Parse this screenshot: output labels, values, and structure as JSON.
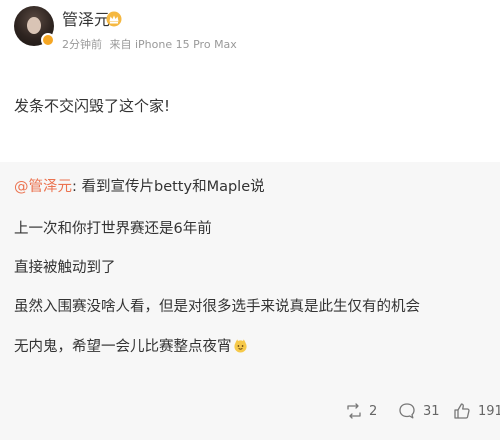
{
  "post": {
    "author": "管泽元",
    "time": "2分钟前",
    "source": "来自 iPhone 15 Pro Max",
    "text": "发条不交闪毁了这个家!"
  },
  "repost": {
    "mention": "@管泽元",
    "first_line": ": 看到宣传片betty和Maple说",
    "lines": [
      "上一次和你打世界赛还是6年前",
      "直接被触动到了",
      "虽然入围赛没啥人看，但是对很多选手来说真是此生仅有的机会",
      "无内鬼，希望一会儿比赛整点夜宵"
    ]
  },
  "actions": {
    "reposts": "2",
    "comments": "31",
    "likes": "191"
  },
  "colors": {
    "mention": "#eb7350",
    "badge": "#f5a623",
    "repost_bg": "#f7f7f7"
  },
  "icons": [
    "crown-icon",
    "verified-badge-icon",
    "emoji-icon",
    "repost-icon",
    "comment-icon",
    "like-icon"
  ]
}
